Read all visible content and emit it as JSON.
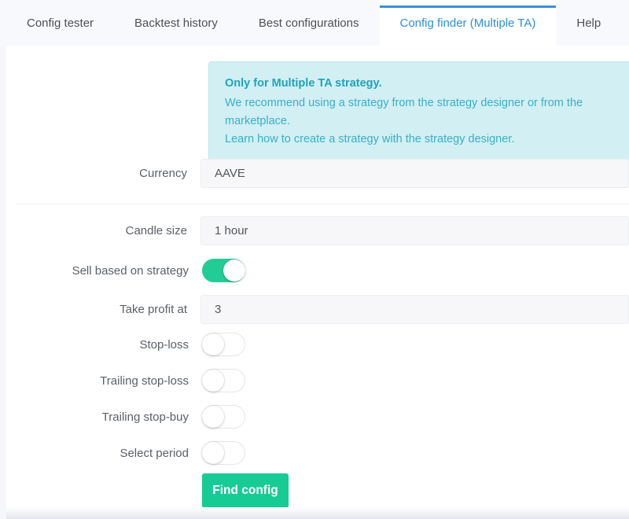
{
  "tabs": [
    {
      "label": "Config tester",
      "active": false
    },
    {
      "label": "Backtest history",
      "active": false
    },
    {
      "label": "Best configurations",
      "active": false
    },
    {
      "label": "Config finder (Multiple TA)",
      "active": true
    },
    {
      "label": "Help",
      "active": false
    }
  ],
  "notice": {
    "title": "Only for Multiple TA strategy.",
    "line1": "We recommend using a strategy from the strategy designer or from the marketplace.",
    "line2": "Learn how to create a strategy with the strategy designer."
  },
  "form": {
    "currency": {
      "label": "Currency",
      "value": "AAVE"
    },
    "candle_size": {
      "label": "Candle size",
      "value": "1 hour"
    },
    "sell_based_on_strategy": {
      "label": "Sell based on strategy",
      "state": "on"
    },
    "take_profit_at": {
      "label": "Take profit at",
      "value": "3"
    },
    "stop_loss": {
      "label": "Stop-loss",
      "state": "off"
    },
    "trailing_stop_loss": {
      "label": "Trailing stop-loss",
      "state": "off"
    },
    "trailing_stop_buy": {
      "label": "Trailing stop-buy",
      "state": "off"
    },
    "select_period": {
      "label": "Select period",
      "state": "off"
    }
  },
  "actions": {
    "find_config": "Find config"
  },
  "colors": {
    "accent_green": "#17cc94",
    "tab_active_blue": "#3b8ee0",
    "notice_bg": "#d2eff4",
    "notice_text": "#2aa9c0"
  }
}
